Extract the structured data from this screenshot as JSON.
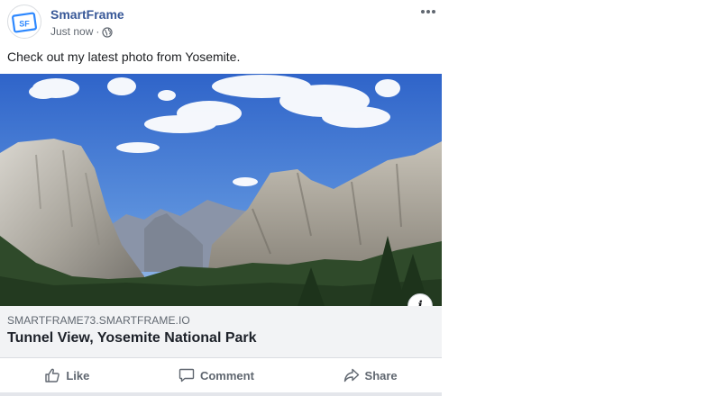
{
  "post": {
    "page_name": "SmartFrame",
    "avatar_text": "SF",
    "timestamp": "Just now",
    "separator": "·",
    "audience_icon": "globe-icon",
    "more_icon": "more-dots-icon",
    "text": "Check out my latest photo from Yosemite."
  },
  "photo": {
    "subject": "Tunnel View, Yosemite National Park",
    "info_label": "i"
  },
  "link_preview": {
    "domain": "SMARTFRAME73.SMARTFRAME.IO",
    "title": "Tunnel View, Yosemite National Park"
  },
  "actions": {
    "like_label": "Like",
    "comment_label": "Comment",
    "share_label": "Share"
  },
  "colors": {
    "brand_blue": "#385898",
    "logo_blue": "#2d88ff",
    "meta_gray": "#606770",
    "preview_bg": "#f2f3f5"
  }
}
